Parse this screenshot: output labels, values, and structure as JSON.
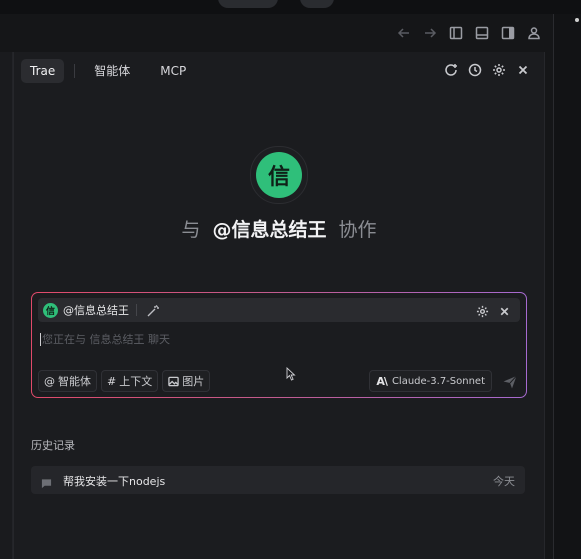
{
  "nav": {
    "back": "←",
    "forward": "→"
  },
  "tabs": [
    {
      "label": "Trae",
      "active": true
    },
    {
      "label": "智能体",
      "active": false
    },
    {
      "label": "MCP",
      "active": false
    }
  ],
  "hero": {
    "avatar_char": "信",
    "prefix": "与",
    "agent": "@信息总结王",
    "suffix": "协作"
  },
  "input": {
    "agent_avatar_char": "信",
    "agent_label": "@信息总结王",
    "placeholder": "您正在与 信息总结王 聊天",
    "chips": [
      {
        "symbol": "@",
        "label": "智能体"
      },
      {
        "symbol": "#",
        "label": "上下文"
      },
      {
        "icon": "image-icon",
        "label": "图片"
      }
    ],
    "model_logo": "A\\",
    "model": "Claude-3.7-Sonnet"
  },
  "history": {
    "label": "历史记录",
    "items": [
      {
        "title": "帮我安装一下nodejs",
        "time": "今天"
      }
    ]
  },
  "colors": {
    "accent_green": "#2fbf7a",
    "gradient_start": "#e14a6a",
    "gradient_end": "#a66ad0"
  }
}
